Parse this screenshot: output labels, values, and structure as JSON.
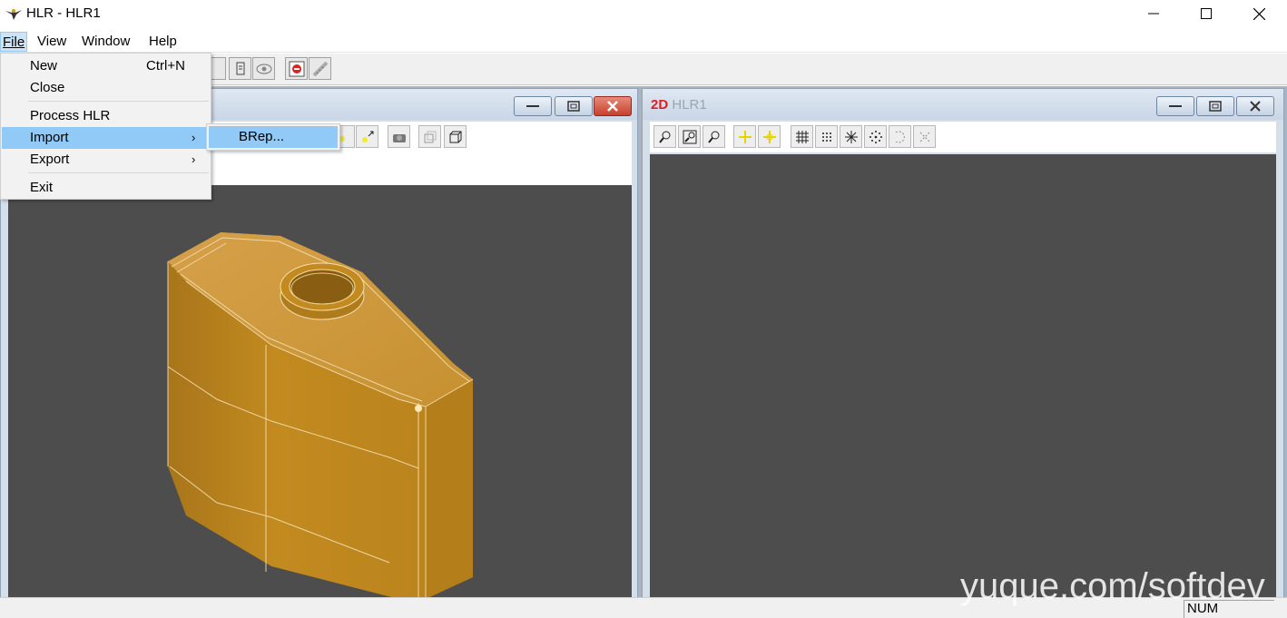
{
  "app": {
    "title": "HLR - HLR1",
    "icon": "bird-logo-icon"
  },
  "window_controls": {
    "minimize": "minimize-icon",
    "maximize": "maximize-icon",
    "close": "close-icon"
  },
  "menubar": {
    "file": "File",
    "view": "View",
    "window": "Window",
    "help": "Help"
  },
  "file_menu": {
    "new": "New",
    "new_shortcut": "Ctrl+N",
    "close": "Close",
    "process_hlr": "Process HLR",
    "import": "Import",
    "export": "Export",
    "exit": "Exit",
    "submenu_arrow": "›"
  },
  "import_submenu": {
    "brep": "BRep..."
  },
  "window_2d": {
    "prefix": "2D",
    "name": "HLR1"
  },
  "statusbar": {
    "num": "NUM"
  },
  "watermark": "yuque.com/softdev",
  "colors": {
    "model": "#c28a1f",
    "viewport": "#4d4d4d",
    "menu_highlight": "#91c9f7",
    "close_red": "#c7402c"
  }
}
